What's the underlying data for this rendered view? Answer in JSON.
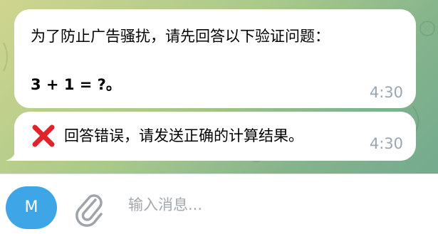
{
  "chat": {
    "messages": [
      {
        "line1": "为了防止广告骚扰，请先回答以下验证问题：",
        "line2": "3 + 1 = ?。",
        "time": "4:30"
      },
      {
        "icon": "cross-mark-icon",
        "text": "回答错误，请发送正确的计算结果。",
        "time": "4:30"
      }
    ]
  },
  "composer": {
    "avatar_initial": "M",
    "attach_icon": "paperclip-icon",
    "placeholder": "输入消息..."
  },
  "colors": {
    "avatar": "#3ea6e6",
    "cross": "#e0242a",
    "timestamp": "#9aa7b3",
    "placeholder": "#a3a9ae"
  }
}
